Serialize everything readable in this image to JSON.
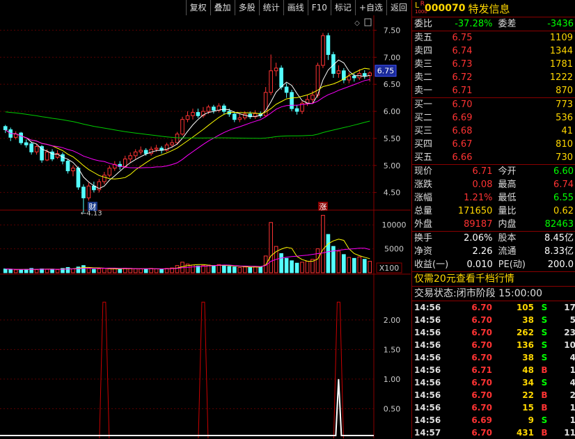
{
  "toolbar": [
    "复权",
    "叠加",
    "多股",
    "统计",
    "画线",
    "F10",
    "标记",
    "+自选",
    "返回"
  ],
  "stock": {
    "lr_top": "R",
    "lr_mid": "L",
    "lr_bot": "1000",
    "code": "000070",
    "name": "特发信息"
  },
  "weibi": {
    "label": "委比",
    "value": "-37.28%",
    "label2": "委差",
    "value2": "-3436"
  },
  "asks": [
    {
      "label": "卖五",
      "price": "6.75",
      "vol": "1109"
    },
    {
      "label": "卖四",
      "price": "6.74",
      "vol": "1344"
    },
    {
      "label": "卖三",
      "price": "6.73",
      "vol": "1781"
    },
    {
      "label": "卖二",
      "price": "6.72",
      "vol": "1222"
    },
    {
      "label": "卖一",
      "price": "6.71",
      "vol": "870"
    }
  ],
  "bids": [
    {
      "label": "买一",
      "price": "6.70",
      "vol": "773"
    },
    {
      "label": "买二",
      "price": "6.69",
      "vol": "536"
    },
    {
      "label": "买三",
      "price": "6.68",
      "vol": "41"
    },
    {
      "label": "买四",
      "price": "6.67",
      "vol": "810"
    },
    {
      "label": "买五",
      "price": "6.66",
      "vol": "730"
    }
  ],
  "stats": [
    {
      "l1": "现价",
      "v1": "6.71",
      "c1": "red",
      "l2": "今开",
      "v2": "6.60",
      "c2": "grn"
    },
    {
      "l1": "涨跌",
      "v1": "0.08",
      "c1": "red",
      "l2": "最高",
      "v2": "6.74",
      "c2": "red"
    },
    {
      "l1": "涨幅",
      "v1": "1.21%",
      "c1": "red",
      "l2": "最低",
      "v2": "6.55",
      "c2": "grn"
    },
    {
      "l1": "总量",
      "v1": "171650",
      "c1": "yel",
      "l2": "量比",
      "v2": "0.62",
      "c2": "yel"
    },
    {
      "l1": "外盘",
      "v1": "89187",
      "c1": "red",
      "l2": "内盘",
      "v2": "82463",
      "c2": "grn"
    }
  ],
  "stats2": [
    {
      "l1": "换手",
      "v1": "2.06%",
      "l2": "股本",
      "v2": "8.45亿"
    },
    {
      "l1": "净资",
      "v1": "2.26",
      "l2": "流通",
      "v2": "8.33亿"
    },
    {
      "l1": "收益(一)",
      "v1": "0.010",
      "l2": "PE(动)",
      "v2": "200.0"
    }
  ],
  "promo": "仅需20元查看千档行情",
  "status": {
    "label": "交易状态:",
    "phase": "闭市阶段",
    "time": "15:00:00"
  },
  "ticks": [
    {
      "t": "14:56",
      "p": "6.70",
      "v": "105",
      "f": "S",
      "n": "17"
    },
    {
      "t": "14:56",
      "p": "6.70",
      "v": "38",
      "f": "S",
      "n": "5"
    },
    {
      "t": "14:56",
      "p": "6.70",
      "v": "262",
      "f": "S",
      "n": "23"
    },
    {
      "t": "14:56",
      "p": "6.70",
      "v": "136",
      "f": "S",
      "n": "10"
    },
    {
      "t": "14:56",
      "p": "6.70",
      "v": "38",
      "f": "S",
      "n": "4"
    },
    {
      "t": "14:56",
      "p": "6.71",
      "v": "48",
      "f": "B",
      "n": "1"
    },
    {
      "t": "14:56",
      "p": "6.70",
      "v": "34",
      "f": "S",
      "n": "4"
    },
    {
      "t": "14:56",
      "p": "6.70",
      "v": "22",
      "f": "B",
      "n": "2"
    },
    {
      "t": "14:56",
      "p": "6.70",
      "v": "15",
      "f": "B",
      "n": "1"
    },
    {
      "t": "14:56",
      "p": "6.69",
      "v": "9",
      "f": "S",
      "n": "1"
    },
    {
      "t": "14:57",
      "p": "6.70",
      "v": "431",
      "f": "B",
      "n": "11"
    }
  ],
  "chart_labels": {
    "low_marker": "4.13",
    "cai": "财",
    "zhang": "涨",
    "cur_price": "6.75",
    "vol_mult": "X100"
  },
  "chart_data": {
    "type": "candlestick",
    "price_ticks": [
      "7.50",
      "7.00",
      "6.50",
      "6.00",
      "5.50",
      "5.00",
      "4.50"
    ],
    "volume_ticks": [
      "10000",
      "5000"
    ],
    "indicator_ticks": [
      "2.00",
      "1.50",
      "1.00",
      "0.50"
    ],
    "price_ylim": [
      4.2,
      7.75
    ],
    "candles": [
      [
        5.72,
        5.66,
        5.75,
        5.6
      ],
      [
        5.66,
        5.52,
        5.7,
        5.45
      ],
      [
        5.52,
        5.58,
        5.63,
        5.48
      ],
      [
        5.6,
        5.42,
        5.62,
        5.38
      ],
      [
        5.42,
        5.38,
        5.48,
        5.33
      ],
      [
        5.4,
        5.25,
        5.44,
        5.2
      ],
      [
        5.25,
        5.35,
        5.4,
        5.2
      ],
      [
        5.35,
        5.1,
        5.38,
        5.05
      ],
      [
        5.1,
        5.25,
        5.3,
        5.08
      ],
      [
        5.25,
        5.12,
        5.3,
        5.08
      ],
      [
        5.15,
        5.22,
        5.28,
        5.12
      ],
      [
        5.2,
        5.08,
        5.24,
        5.02
      ],
      [
        5.08,
        4.9,
        5.12,
        4.85
      ],
      [
        4.9,
        4.95,
        5.0,
        4.8
      ],
      [
        4.95,
        4.6,
        4.98,
        4.55
      ],
      [
        4.6,
        4.4,
        4.65,
        4.13
      ],
      [
        4.4,
        4.62,
        4.68,
        4.35
      ],
      [
        4.62,
        4.55,
        4.7,
        4.5
      ],
      [
        4.55,
        4.7,
        4.75,
        4.5
      ],
      [
        4.7,
        4.82,
        4.88,
        4.65
      ],
      [
        4.82,
        4.95,
        5.0,
        4.78
      ],
      [
        4.95,
        5.02,
        5.08,
        4.9
      ],
      [
        5.02,
        4.98,
        5.08,
        4.92
      ],
      [
        4.98,
        5.12,
        5.18,
        4.95
      ],
      [
        5.12,
        5.18,
        5.24,
        5.05
      ],
      [
        5.18,
        5.25,
        5.3,
        5.12
      ],
      [
        5.25,
        5.28,
        5.35,
        5.2
      ],
      [
        5.28,
        5.22,
        5.32,
        5.18
      ],
      [
        5.22,
        5.3,
        5.35,
        5.18
      ],
      [
        5.3,
        5.32,
        5.38,
        5.25
      ],
      [
        5.32,
        5.28,
        5.36,
        5.22
      ],
      [
        5.28,
        5.38,
        5.42,
        5.25
      ],
      [
        5.38,
        5.42,
        5.48,
        5.33
      ],
      [
        5.42,
        5.58,
        5.62,
        5.38
      ],
      [
        5.58,
        5.85,
        5.9,
        5.55
      ],
      [
        5.85,
        5.92,
        6.0,
        5.8
      ],
      [
        5.92,
        5.98,
        6.05,
        5.85
      ],
      [
        5.98,
        5.92,
        6.05,
        5.88
      ],
      [
        5.92,
        6.0,
        6.08,
        5.88
      ],
      [
        6.0,
        6.08,
        6.12,
        5.95
      ],
      [
        6.08,
        6.02,
        6.12,
        5.96
      ],
      [
        6.02,
        6.1,
        6.15,
        5.98
      ],
      [
        6.1,
        6.0,
        6.14,
        5.94
      ],
      [
        6.0,
        5.95,
        6.05,
        5.9
      ],
      [
        5.95,
        5.85,
        6.0,
        5.8
      ],
      [
        5.85,
        5.88,
        5.95,
        5.8
      ],
      [
        5.88,
        5.95,
        6.0,
        5.84
      ],
      [
        5.95,
        5.9,
        6.0,
        5.86
      ],
      [
        5.9,
        5.96,
        6.02,
        5.86
      ],
      [
        5.96,
        5.92,
        6.0,
        5.88
      ],
      [
        5.92,
        6.35,
        6.45,
        5.9
      ],
      [
        6.35,
        6.75,
        7.05,
        6.3
      ],
      [
        6.75,
        6.8,
        6.9,
        6.65
      ],
      [
        6.8,
        6.45,
        6.85,
        6.4
      ],
      [
        6.45,
        6.35,
        6.52,
        6.25
      ],
      [
        6.35,
        6.05,
        6.4,
        6.0
      ],
      [
        6.05,
        6.0,
        6.12,
        5.94
      ],
      [
        6.0,
        6.15,
        6.2,
        5.95
      ],
      [
        6.15,
        6.22,
        6.3,
        6.1
      ],
      [
        6.22,
        6.3,
        6.38,
        6.15
      ],
      [
        6.3,
        6.85,
        6.9,
        6.25
      ],
      [
        6.85,
        7.4,
        7.45,
        6.8
      ],
      [
        7.4,
        7.05,
        7.45,
        6.95
      ],
      [
        7.05,
        6.7,
        7.1,
        6.62
      ],
      [
        6.7,
        6.75,
        6.85,
        6.62
      ],
      [
        6.75,
        6.58,
        6.8,
        6.52
      ],
      [
        6.58,
        6.65,
        6.72,
        6.52
      ],
      [
        6.65,
        6.62,
        6.7,
        6.55
      ],
      [
        6.62,
        6.7,
        6.78,
        6.58
      ],
      [
        6.7,
        6.66,
        6.76,
        6.6
      ],
      [
        6.66,
        6.71,
        6.74,
        6.55
      ]
    ],
    "volumes": [
      800,
      700,
      600,
      650,
      700,
      900,
      650,
      800,
      700,
      750,
      650,
      900,
      1100,
      800,
      1200,
      1500,
      900,
      700,
      800,
      900,
      850,
      800,
      700,
      950,
      900,
      850,
      800,
      750,
      900,
      800,
      750,
      900,
      1000,
      1500,
      2200,
      1800,
      1600,
      1400,
      1500,
      1600,
      1400,
      1700,
      1500,
      1300,
      1200,
      1100,
      1200,
      1100,
      1300,
      1200,
      3500,
      10500,
      5500,
      4000,
      3000,
      2500,
      2000,
      2200,
      2400,
      2800,
      5000,
      12000,
      8000,
      5500,
      4500,
      3800,
      3200,
      3000,
      3300,
      2800,
      2400
    ],
    "indicator_peaks": [
      {
        "index": 19,
        "value": 2.3
      },
      {
        "index": 38,
        "value": 2.3
      },
      {
        "index": 64,
        "value": 2.3
      }
    ],
    "indicator_white": {
      "index": 64,
      "value": 1.0
    }
  }
}
